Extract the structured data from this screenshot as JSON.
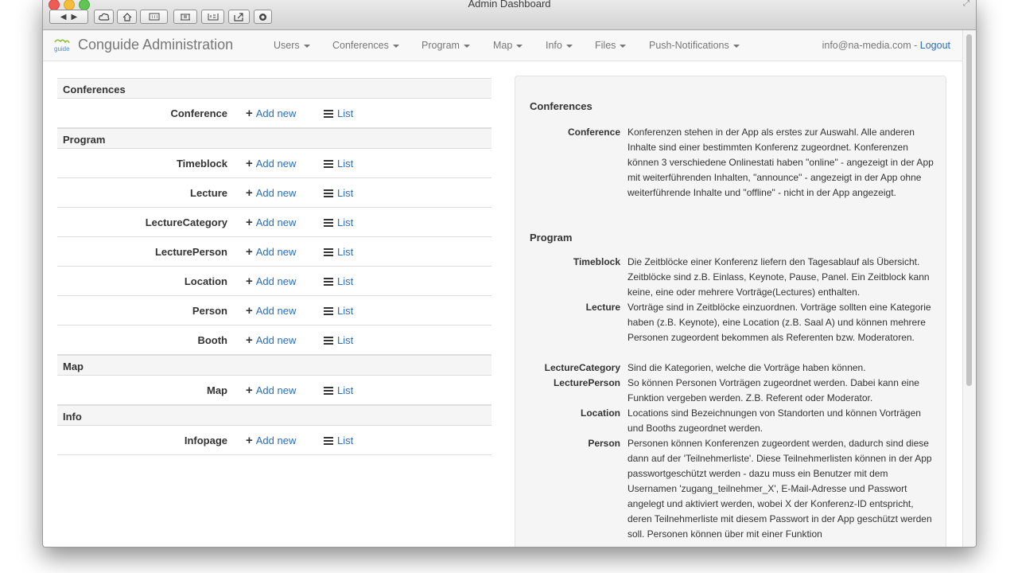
{
  "window": {
    "title": "Admin Dashboard"
  },
  "toolbar": {
    "buttons": [
      {
        "icon": "back-forward-icon"
      },
      {
        "icon": "cloud-icon"
      },
      {
        "icon": "home-icon"
      },
      {
        "icon": "grid-icon"
      },
      {
        "icon": "bookmarks-icon"
      },
      {
        "icon": "reader-icon"
      },
      {
        "icon": "share-icon"
      },
      {
        "icon": "block-icon"
      }
    ]
  },
  "navbar": {
    "brand": "Conguide Administration",
    "items": [
      {
        "label": "Users"
      },
      {
        "label": "Conferences"
      },
      {
        "label": "Program"
      },
      {
        "label": "Map"
      },
      {
        "label": "Info"
      },
      {
        "label": "Files"
      },
      {
        "label": "Push-Notifications"
      }
    ],
    "user_email": "info@na-media.com",
    "separator": " - ",
    "logout": "Logout"
  },
  "actions": {
    "add": "Add new",
    "list": "List"
  },
  "sections": [
    {
      "title": "Conferences",
      "entities": [
        "Conference"
      ]
    },
    {
      "title": "Program",
      "entities": [
        "Timeblock",
        "Lecture",
        "LectureCategory",
        "LecturePerson",
        "Location",
        "Person",
        "Booth"
      ]
    },
    {
      "title": "Map",
      "entities": [
        "Map"
      ]
    },
    {
      "title": "Info",
      "entities": [
        "Infopage"
      ]
    }
  ],
  "help": {
    "conferences_title": "Conferences",
    "conference_term": "Conference",
    "conference_desc": "Konferenzen stehen in der App als erstes zur Auswahl. Alle anderen Inhalte sind einer bestimmten Konferenz zugeordnet. Konferenzen können 3 verschiedene Onlinestati haben \"online\" - angezeigt in der App mit weiterführenden Inhalten, \"announce\" - angezeigt in der App ohne weiterführende Inhalte und \"offline\" - nicht in der App angezeigt.",
    "program_title": "Program",
    "timeblock_term": "Timeblock",
    "timeblock_desc": "Die Zeitblöcke einer Konferenz liefern den Tagesablauf als Übersicht. Zeitblöcke sind z.B. Einlass, Keynote, Pause, Panel. Ein Zeitblock kann keine, eine oder mehrere Vorträge(Lectures) enthalten.",
    "lecture_term": "Lecture",
    "lecture_desc": "Vorträge sind in Zeitblöcke einzuordnen. Vorträge sollten eine Kategorie haben (z.B. Keynote), eine Location (z.B. Saal A) und können mehrere Personen zugeordent bekommen als Referenten bzw. Moderatoren.",
    "lecturecategory_term": "LectureCategory",
    "lecturecategory_desc": "Sind die Kategorien, welche die Vorträge haben können.",
    "lectureperson_term": "LecturePerson",
    "lectureperson_desc": "So können Personen Vorträgen zugeordnet werden. Dabei kann eine Funktion vergeben werden. Z.B. Referent oder Moderator.",
    "location_term": "Location",
    "location_desc": "Locations sind Bezeichnungen von Standorten und können Vorträgen und Booths zugeordnet werden.",
    "person_term": "Person",
    "person_desc": "Personen können Konferenzen zugeordent werden, dadurch sind diese dann auf der 'Teilnehmerliste'. Diese Teilnehmerlisten können in der App passwortgeschützt werden - dazu muss ein Benutzer mit dem Usernamen 'zugang_teilnehmer_X', E-Mail-Adresse und Passwort angelegt und aktiviert werden, wobei X der Konferenz-ID entspricht, deren Teilnehmerliste mit diesem Passwort in der App geschützt werden soll. Personen können über mit einer Funktion"
  }
}
